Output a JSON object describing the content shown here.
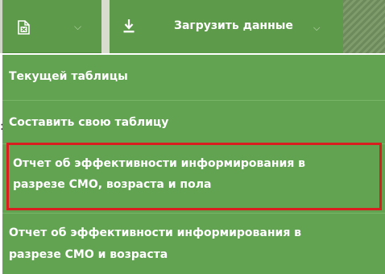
{
  "toolbar": {
    "excel_button_icon": "excel-file-icon",
    "excel_button_caret": "⌵",
    "download_icon": "download-icon",
    "download_label": "Загрузить данные",
    "download_caret": "⌵"
  },
  "menu": {
    "items": [
      {
        "label": "Текущей таблицы"
      },
      {
        "label": "Составить свою таблицу"
      },
      {
        "label_line1": "Отчет об эффективности информирования в",
        "label_line2": "разрезе СМО, возраста и пола",
        "highlighted": true
      },
      {
        "label_line1": "Отчет об эффективности информирования в",
        "label_line2": "разрезе СМО и возраста"
      }
    ]
  },
  "colors": {
    "menu_bg": "#62a351",
    "button_bg": "#5d9a4a",
    "highlight_border": "#d81e1e",
    "text": "#ffffff"
  }
}
